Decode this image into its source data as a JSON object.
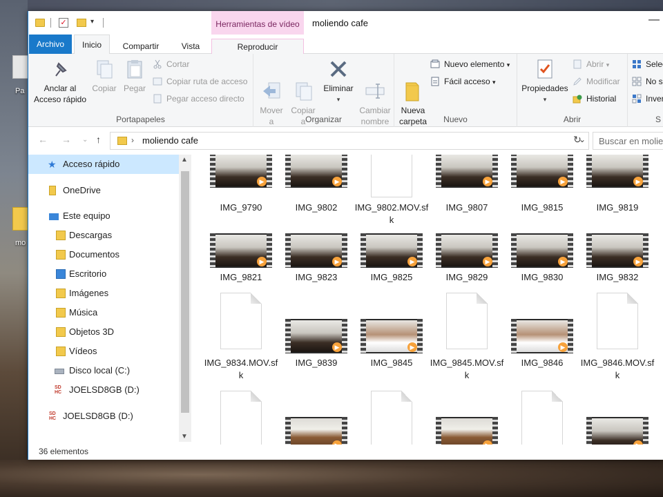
{
  "window": {
    "title": "moliendo cafe"
  },
  "desktop": {
    "label_1": "Pa",
    "label_2": "mo"
  },
  "tabs": {
    "archivo": "Archivo",
    "inicio": "Inicio",
    "compartir": "Compartir",
    "vista": "Vista",
    "contextual_header": "Herramientas de vídeo",
    "reproducir": "Reproducir"
  },
  "ribbon": {
    "portapapeles": {
      "label": "Portapapeles",
      "anclar": "Anclar al\nAcceso rápido",
      "copiar": "Copiar",
      "pegar": "Pegar",
      "cortar": "Cortar",
      "copiar_ruta": "Copiar ruta de acceso",
      "pegar_acceso": "Pegar acceso directo"
    },
    "organizar": {
      "label": "Organizar",
      "mover": "Mover\na",
      "copiar": "Copiar\na",
      "eliminar": "Eliminar",
      "cambiar": "Cambiar\nnombre"
    },
    "nuevo": {
      "label": "Nuevo",
      "nueva_carpeta": "Nueva\ncarpeta",
      "nuevo_elemento": "Nuevo elemento",
      "facil_acceso": "Fácil acceso"
    },
    "abrir": {
      "label": "Abrir",
      "propiedades": "Propiedades",
      "abrir": "Abrir",
      "modificar": "Modificar",
      "historial": "Historial"
    },
    "seleccionar": {
      "label": "S",
      "seleccionar": "Selec",
      "no": "No s",
      "invertir": "Inver"
    }
  },
  "address": {
    "path": "moliendo cafe",
    "search_placeholder": "Buscar en molie"
  },
  "nav": [
    {
      "label": "Acceso rápido",
      "icon": "star-icon"
    },
    {
      "label": "OneDrive",
      "icon": "cloud-icon"
    },
    {
      "label": "Este equipo",
      "icon": "computer-icon"
    },
    {
      "label": "Descargas",
      "icon": "download-folder-icon"
    },
    {
      "label": "Documentos",
      "icon": "documents-folder-icon"
    },
    {
      "label": "Escritorio",
      "icon": "desktop-folder-icon"
    },
    {
      "label": "Imágenes",
      "icon": "pictures-folder-icon"
    },
    {
      "label": "Música",
      "icon": "music-folder-icon"
    },
    {
      "label": "Objetos 3D",
      "icon": "3d-objects-folder-icon"
    },
    {
      "label": "Vídeos",
      "icon": "videos-folder-icon"
    },
    {
      "label": "Disco local (C:)",
      "icon": "drive-icon"
    },
    {
      "label": "JOELSD8GB (D:)",
      "icon": "sd-card-icon"
    },
    {
      "label": "JOELSD8GB (D:)",
      "icon": "sd-card-icon"
    }
  ],
  "files": [
    {
      "name": "IMG_9790",
      "kind": "video"
    },
    {
      "name": "IMG_9802",
      "kind": "video"
    },
    {
      "name": "IMG_9802.MOV.sfk",
      "kind": "file"
    },
    {
      "name": "IMG_9807",
      "kind": "video"
    },
    {
      "name": "IMG_9815",
      "kind": "video"
    },
    {
      "name": "IMG_9819",
      "kind": "video"
    },
    {
      "name": "IMG_9821",
      "kind": "video"
    },
    {
      "name": "IMG_9823",
      "kind": "video"
    },
    {
      "name": "IMG_9825",
      "kind": "video"
    },
    {
      "name": "IMG_9829",
      "kind": "video"
    },
    {
      "name": "IMG_9830",
      "kind": "video"
    },
    {
      "name": "IMG_9832",
      "kind": "video"
    },
    {
      "name": "IMG_9834.MOV.sfk",
      "kind": "file"
    },
    {
      "name": "IMG_9839",
      "kind": "video"
    },
    {
      "name": "IMG_9845",
      "kind": "video-face"
    },
    {
      "name": "IMG_9845.MOV.sfk",
      "kind": "file"
    },
    {
      "name": "IMG_9846",
      "kind": "video-face"
    },
    {
      "name": "IMG_9846.MOV.sfk",
      "kind": "file"
    }
  ],
  "status": {
    "count": "36 elementos"
  }
}
